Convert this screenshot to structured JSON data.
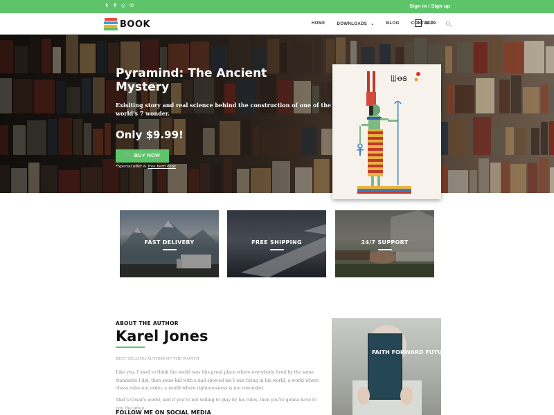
{
  "topbar": {
    "social_icons": [
      "twitter-icon",
      "facebook-icon",
      "instagram-icon",
      "mail-icon"
    ],
    "signin_label": "Sign in / Sign up"
  },
  "header": {
    "logo_text": "BOOK",
    "nav": [
      "HOME",
      "DOWNLOADS",
      "BLOG",
      "CONTACT"
    ],
    "cart_count": "1",
    "cart_total": "$4.99."
  },
  "hero": {
    "title": "Pyramind: The Ancient Mystery",
    "description": "Exisiting story and real science behind the construction of one of the world's 7 wonder.",
    "price": "Only $9.99!",
    "buy_label": "BUY NOW",
    "note_prefix": "*Special offer & ",
    "note_link": "free hard copy",
    "cover_glyphs": "ꡆꝋꞩ"
  },
  "features": [
    {
      "label": "FAST DELIVERY"
    },
    {
      "label": "FREE SHIPPING"
    },
    {
      "label": "24/7 SUPPORT"
    }
  ],
  "about": {
    "eyebrow": "ABOUT THE AUTHOR",
    "name": "Karel Jones",
    "subtitle": "BEST SELLING AUTHOR OF THE MONTH",
    "paragraphs": [
      "Like you, I used to think the world was this great place where everybody lived by the same standards I did, then some kid with a nail showed me I was living in his world, a world where chaos rules not order, a world where righteousness is not rewarded.",
      "That's Cesar's world, and if you're not willing to play by his rules, then you're gonna have to pay the price."
    ],
    "follow_label": "FOLLOW ME ON SOCIAL MEDIA",
    "photo_book_text": "FAITH FORWARD FUTURE"
  },
  "colors": {
    "accent": "#5ec46a",
    "dark_text": "#111111",
    "muted_text": "#888888"
  }
}
